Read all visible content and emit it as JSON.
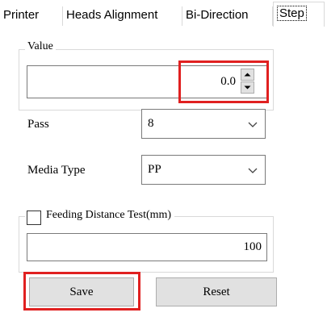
{
  "tabs": [
    {
      "label": "Printer"
    },
    {
      "label": "Heads Alignment"
    },
    {
      "label": "Bi-Direction"
    },
    {
      "label": "Step"
    }
  ],
  "value_group": {
    "legend": "Value",
    "value": "0.0"
  },
  "pass": {
    "label": "Pass",
    "selected": "8"
  },
  "media_type": {
    "label": "Media Type",
    "selected": "PP"
  },
  "feeding": {
    "checkbox_label": "Feeding Distance Test(mm)",
    "checked": false,
    "value": "100"
  },
  "buttons": {
    "save": "Save",
    "reset": "Reset"
  },
  "icons": [
    "spin-up-icon",
    "spin-down-icon",
    "chevron-down-icon"
  ],
  "colors": {
    "highlight": "#e02020",
    "button_bg": "#e1e1e1"
  }
}
